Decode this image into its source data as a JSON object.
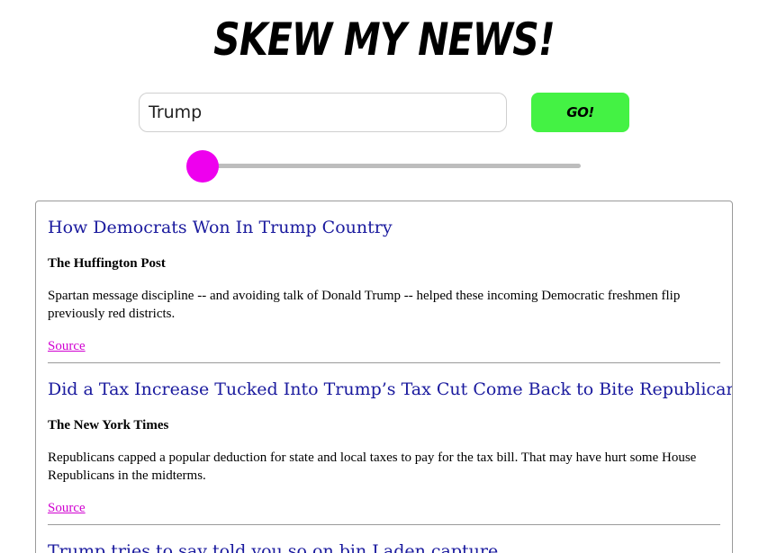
{
  "header": {
    "title": "SKEW MY NEWS!"
  },
  "search": {
    "value": "Trump",
    "placeholder": "",
    "go_label": "GO!"
  },
  "slider": {
    "value_fraction": 0.0,
    "accent_color": "#ee00ee"
  },
  "colors": {
    "go_button": "#44f244",
    "title_link": "#1a1a9e",
    "source_link": "#d000d0"
  },
  "articles": [
    {
      "title": "How Democrats Won In Trump Country",
      "source": "The Huffington Post",
      "description": "Spartan message discipline -- and avoiding talk of Donald Trump -- helped these incoming Democratic freshmen flip previously red districts.",
      "link_label": "Source"
    },
    {
      "title": "Did a Tax Increase Tucked Into Trump’s Tax Cut Come Back to Bite Republicans?",
      "source": "The New York Times",
      "description": "Republicans capped a popular deduction for state and local taxes to pay for the tax bill. That may have hurt some House Republicans in the midterms.",
      "link_label": "Source"
    },
    {
      "title": "Trump tries to say told you so on bin Laden capture",
      "source": "",
      "description": "",
      "link_label": ""
    }
  ]
}
